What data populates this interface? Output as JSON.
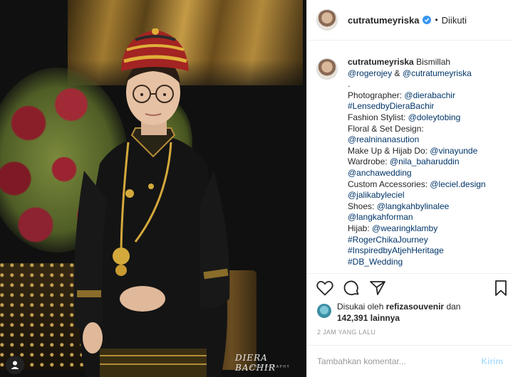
{
  "photo": {
    "watermark": "DIERA BACHIR",
    "watermark_sub": "PHOTOGRAPHY"
  },
  "post": {
    "username": "cutratumeyriska",
    "follow_status": "Diikuti",
    "caption_lines": [
      {
        "parts": [
          {
            "t": "Bismillah",
            "k": "text"
          }
        ]
      },
      {
        "parts": [
          {
            "t": "@rogerojey",
            "k": "link"
          },
          {
            "t": " & ",
            "k": "text"
          },
          {
            "t": "@cutratumeyriska",
            "k": "link"
          }
        ]
      },
      {
        "parts": [
          {
            "t": ".",
            "k": "text"
          }
        ]
      },
      {
        "parts": [
          {
            "t": "Photographer: ",
            "k": "text"
          },
          {
            "t": "@dierabachir",
            "k": "link"
          }
        ]
      },
      {
        "parts": [
          {
            "t": "#LensedbyDieraBachir",
            "k": "link"
          }
        ]
      },
      {
        "parts": [
          {
            "t": "Fashion Stylist: ",
            "k": "text"
          },
          {
            "t": "@doleytobing",
            "k": "link"
          }
        ]
      },
      {
        "parts": [
          {
            "t": "Floral & Set Design:",
            "k": "text"
          }
        ]
      },
      {
        "parts": [
          {
            "t": "@realninanasution",
            "k": "link"
          }
        ]
      },
      {
        "parts": [
          {
            "t": "Make Up & Hijab Do: ",
            "k": "text"
          },
          {
            "t": "@vinayunde",
            "k": "link"
          }
        ]
      },
      {
        "parts": [
          {
            "t": "Wardrobe: ",
            "k": "text"
          },
          {
            "t": "@nila_baharuddin",
            "k": "link"
          }
        ]
      },
      {
        "parts": [
          {
            "t": "@anchawedding",
            "k": "link"
          }
        ]
      },
      {
        "parts": [
          {
            "t": "Custom Accessories: ",
            "k": "text"
          },
          {
            "t": "@leciel.design",
            "k": "link"
          }
        ]
      },
      {
        "parts": [
          {
            "t": "@jalikabyleciel",
            "k": "link"
          }
        ]
      },
      {
        "parts": [
          {
            "t": "Shoes: ",
            "k": "text"
          },
          {
            "t": "@langkahbylinalee",
            "k": "link"
          }
        ]
      },
      {
        "parts": [
          {
            "t": "@langkahforman",
            "k": "link"
          }
        ]
      },
      {
        "parts": [
          {
            "t": "Hijab: ",
            "k": "text"
          },
          {
            "t": "@wearingklamby",
            "k": "link"
          }
        ]
      },
      {
        "parts": [
          {
            "t": "#RogerChikaJourney",
            "k": "link"
          }
        ]
      },
      {
        "parts": [
          {
            "t": "#InspiredbyAtjehHeritage",
            "k": "link"
          }
        ]
      },
      {
        "parts": [
          {
            "t": "#DB_Wedding",
            "k": "link"
          }
        ]
      }
    ],
    "likes_prefix": "Disukai oleh",
    "likes_user": "refizasouvenir",
    "likes_conj": "dan",
    "likes_count": "142,391",
    "likes_suffix": "lainnya",
    "time": "2 JAM YANG LALU",
    "comment_placeholder": "Tambahkan komentar...",
    "post_button": "Kirim"
  },
  "icons": {
    "like": "heart-icon",
    "comment": "comment-icon",
    "share": "share-icon",
    "save": "bookmark-icon",
    "verified": "verified-badge-icon",
    "profile": "user-icon"
  },
  "colors": {
    "link": "#003569",
    "verified": "#3897f0",
    "muted": "#999999",
    "post_button": "#b2dffc"
  }
}
